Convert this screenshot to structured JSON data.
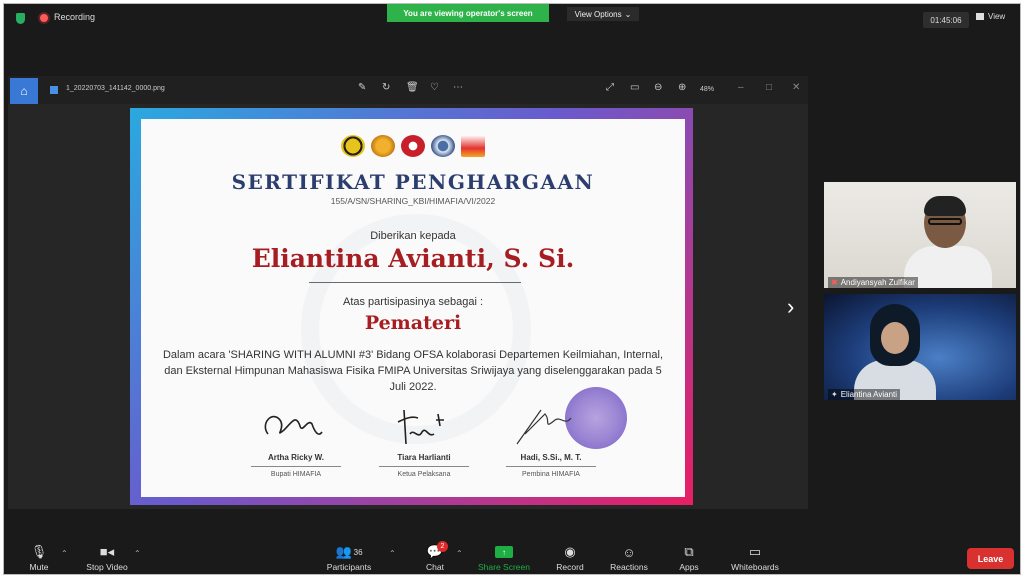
{
  "topbar": {
    "recording_label": "Recording",
    "banner_text": "You are viewing operator's screen",
    "view_options_label": "View Options",
    "timer": "01:45:06",
    "view_label": "View"
  },
  "viewer": {
    "filename": "1_20220703_141142_0000.png",
    "zoom": "48%"
  },
  "certificate": {
    "title": "SERTIFIKAT PENGHARGAAN",
    "number": "155/A/SN/SHARING_KBI/HIMAFIA/VI/2022",
    "given_to": "Diberikan kepada",
    "recipient": "Eliantina Avianti, S. Si.",
    "participation": "Atas partisipasinya sebagai :",
    "role": "Pemateri",
    "body": "Dalam acara 'SHARING WITH ALUMNI #3' Bidang OFSA kolaborasi Departemen Keilmiahan, Internal, dan Eksternal Himpunan Mahasiswa Fisika FMIPA Universitas Sriwijaya yang diselenggarakan pada 5 Juli 2022.",
    "signers": [
      {
        "name": "Artha Ricky W.",
        "role": "Bupati HIMAFIA"
      },
      {
        "name": "Tiara Harlianti",
        "role": "Ketua Pelaksana"
      },
      {
        "name": "Hadi, S.Si., M. T.",
        "role": "Pembina HIMAFIA"
      }
    ]
  },
  "participants": [
    {
      "name": "Andiyansyah Zulfikar"
    },
    {
      "name": "Eliantina Avianti"
    }
  ],
  "toolbar": {
    "mute": "Mute",
    "stop_video": "Stop Video",
    "participants": "Participants",
    "participants_count": "36",
    "chat": "Chat",
    "chat_badge": "2",
    "share_screen": "Share Screen",
    "record": "Record",
    "reactions": "Reactions",
    "apps": "Apps",
    "whiteboards": "Whiteboards",
    "leave": "Leave"
  },
  "colors": {
    "share_green": "#1fae46",
    "leave_red": "#d93030",
    "banner_green": "#2db34a",
    "cert_title": "#2c3e70",
    "cert_name": "#a61d22"
  }
}
